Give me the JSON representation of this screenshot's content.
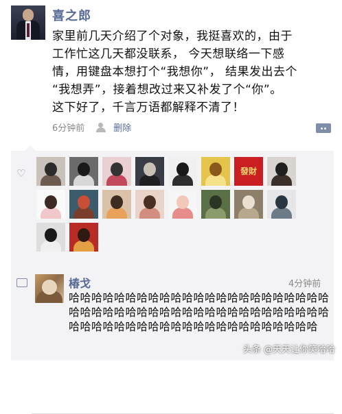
{
  "post": {
    "author": "喜之郎",
    "text_lines": [
      "家里前几天介绍了个对象，我挺喜欢的，由于",
      "工作忙这几天都没联系， 今天想联络一下感",
      "情，用键盘本想打个“我想你”， 结果发出去个",
      "“我想弄”，接着想改过来又补发了个“你”。",
      "这下好了，千言万语都解释不清了！"
    ],
    "time": "6分钟前",
    "delete_label": "删除",
    "friend_icon": "friends-icon",
    "comment_icon": "comment-more-icon"
  },
  "likes": {
    "icon": "heart-icon",
    "avatars": [
      {
        "name": "liker-1",
        "bg": "#c9c2bb",
        "fg": "#2b2b2b",
        "alt": "#6d5b4f"
      },
      {
        "name": "liker-2",
        "bg": "#6b6b6b",
        "fg": "#1a1a1a",
        "alt": "#d8d8d8"
      },
      {
        "name": "liker-3",
        "bg": "#ead0d3",
        "fg": "#333333",
        "alt": "#c04a5b"
      },
      {
        "name": "liker-4",
        "bg": "#3a3c45",
        "fg": "#c8c0b5",
        "alt": "#202024"
      },
      {
        "name": "liker-5",
        "bg": "#f0f0f0",
        "fg": "#1a1a1a",
        "alt": "#2d2d2d"
      },
      {
        "name": "liker-6",
        "bg": "#e4c44a",
        "fg": "#8a5a1c",
        "alt": "#f5e28a"
      },
      {
        "name": "liker-7",
        "bg": "#c91f23",
        "fg": "#c91f23",
        "alt": "#c91f23",
        "glyph": "發財"
      },
      {
        "name": "liker-8",
        "bg": "#d8d4cf",
        "fg": "#1f1f1f",
        "alt": "#3b2f2a"
      },
      {
        "name": "liker-9",
        "bg": "#fafafa",
        "fg": "#3b2b24",
        "alt": "#f2c7c9"
      },
      {
        "name": "liker-10",
        "bg": "#3b5c6d",
        "fg": "#c94f34",
        "alt": "#7a3f2c"
      },
      {
        "name": "liker-11",
        "bg": "#d9c2a8",
        "fg": "#3d2d20",
        "alt": "#e8a25c"
      },
      {
        "name": "liker-12",
        "bg": "#ead3c9",
        "fg": "#4a2f26",
        "alt": "#d18d7f"
      },
      {
        "name": "liker-13",
        "bg": "#f6f6f6",
        "fg": "#f2c9b9",
        "alt": "#e88b8b"
      },
      {
        "name": "liker-14",
        "bg": "#5a6f45",
        "fg": "#2b3524",
        "alt": "#8a9c6b"
      },
      {
        "name": "liker-15",
        "bg": "#8d7f6a",
        "fg": "#e9e0d2",
        "alt": "#b8a88e"
      },
      {
        "name": "liker-16",
        "bg": "#e6e6e8",
        "fg": "#293540",
        "alt": "#6b7b88"
      },
      {
        "name": "liker-17",
        "bg": "#dedede",
        "fg": "#1a1a1a",
        "alt": "#f0f0f0"
      },
      {
        "name": "liker-18",
        "bg": "#b92b25",
        "fg": "#2e1a12",
        "alt": "#e4a042"
      }
    ]
  },
  "comment": {
    "icon": "comment-icon",
    "author": "椿戈",
    "time": "4分钟前",
    "text": "哈哈哈哈哈哈哈哈哈哈哈哈哈哈哈哈哈哈哈哈哈哈哈哈哈哈哈哈哈哈哈哈哈哈哈哈哈哈哈哈哈哈哈哈哈哈哈哈哈哈哈哈哈哈哈哈哈哈哈哈哈哈哈哈哈哈哈哈"
  },
  "watermark": "头条 @天天让你笑哈哈"
}
